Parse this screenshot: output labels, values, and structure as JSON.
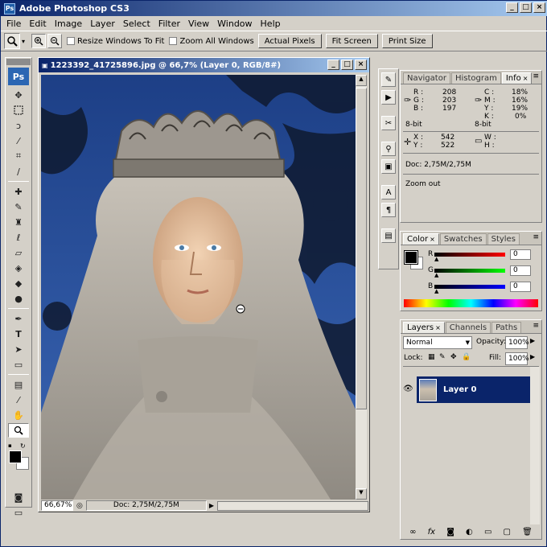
{
  "app": {
    "title": "Adobe Photoshop CS3",
    "logo": "Ps"
  },
  "window_controls": {
    "minimize": "_",
    "maximize": "□",
    "close": "×"
  },
  "menu": [
    "File",
    "Edit",
    "Image",
    "Layer",
    "Select",
    "Filter",
    "View",
    "Window",
    "Help"
  ],
  "options_bar": {
    "tool_icon": "zoom-icon",
    "resize_windows_label": "Resize Windows To Fit",
    "zoom_all_windows_label": "Zoom All Windows",
    "actual_pixels": "Actual Pixels",
    "fit_screen": "Fit Screen",
    "print_size": "Print Size"
  },
  "toolbox": {
    "logo": "Ps"
  },
  "document": {
    "title": "1223392_41725896.jpg @ 66,7% (Layer 0, RGB/8#)",
    "zoom": "66,67%",
    "doc_size": "Doc: 2,75M/2,75M"
  },
  "info_panel": {
    "tabs": [
      "Navigator",
      "Histogram",
      "Info"
    ],
    "active_tab": "Info",
    "r_label": "R :",
    "r": "208",
    "g_label": "G :",
    "g": "203",
    "b_label": "B :",
    "b": "197",
    "c_label": "C :",
    "c": "18%",
    "m_label": "M :",
    "m": "16%",
    "y_label": "Y :",
    "y": "19%",
    "k_label": "K :",
    "k": "0%",
    "bit_left": "8-bit",
    "bit_right": "8-bit",
    "x_label": "X :",
    "x": "542",
    "y_coord_label": "Y :",
    "y_coord": "522",
    "w_label": "W :",
    "h_label": "H :",
    "doc": "Doc: 2,75M/2,75M",
    "hint": "Zoom out"
  },
  "color_panel": {
    "tabs": [
      "Color",
      "Swatches",
      "Styles"
    ],
    "active_tab": "Color",
    "r_label": "R",
    "r": "0",
    "g_label": "G",
    "g": "0",
    "b_label": "B",
    "b": "0"
  },
  "layers_panel": {
    "tabs": [
      "Layers",
      "Channels",
      "Paths"
    ],
    "active_tab": "Layers",
    "blend_mode": "Normal",
    "opacity_label": "Opacity:",
    "opacity": "100%",
    "lock_label": "Lock:",
    "fill_label": "Fill:",
    "fill": "100%",
    "layer_name": "Layer 0"
  },
  "colors": {
    "title_start": "#0a246a",
    "title_end": "#a6caf0",
    "chrome": "#d4d0c8",
    "selection": "#0a246a"
  }
}
